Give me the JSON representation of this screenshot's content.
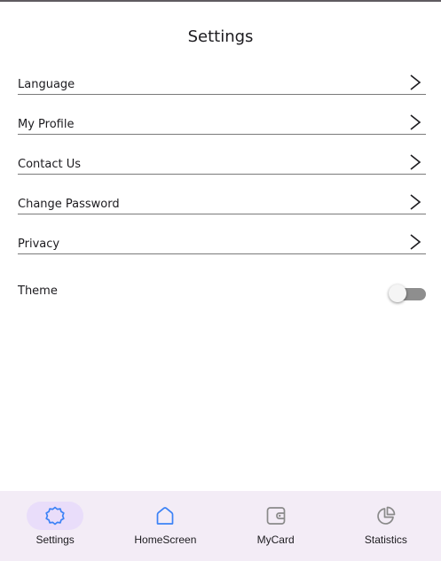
{
  "header": {
    "title": "Settings"
  },
  "settings_items": [
    {
      "label": "Language"
    },
    {
      "label": "My Profile"
    },
    {
      "label": "Contact Us"
    },
    {
      "label": "Change Password"
    },
    {
      "label": "Privacy"
    }
  ],
  "theme": {
    "label": "Theme",
    "enabled": false
  },
  "bottom_nav": {
    "items": [
      {
        "label": "Settings",
        "icon": "settings-icon",
        "active": true
      },
      {
        "label": "HomeScreen",
        "icon": "home-icon",
        "active": false
      },
      {
        "label": "MyCard",
        "icon": "wallet-icon",
        "active": false
      },
      {
        "label": "Statistics",
        "icon": "pie-chart-icon",
        "active": false
      }
    ]
  },
  "colors": {
    "accent": "#3b82f6",
    "nav_background": "#f3ecf6",
    "active_indicator": "#e9ddfa",
    "inactive_icon": "#8a8a8a"
  }
}
